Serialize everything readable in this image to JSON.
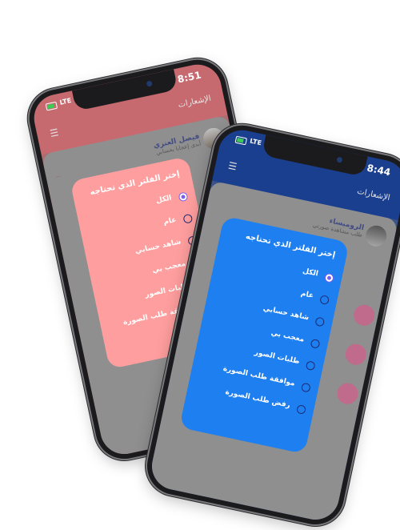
{
  "phone_left": {
    "status": {
      "time": "8:51",
      "network": "LTE"
    },
    "header": {
      "title": "الإشعارات",
      "filter_icon": "filter-icon"
    },
    "profile": {
      "name": "فيصل العنزي",
      "subtitle": "أبدى إعجابا بحسابي"
    },
    "filter_sheet": {
      "title": "إختر الفلتر الذي تحتاجه",
      "options": [
        "الكل",
        "عام",
        "شاهد حسابي",
        "معجب بي",
        "طلبات الصور",
        "موافقة طلب الصورة"
      ]
    },
    "colors": {
      "header": "#c76a70",
      "sheet": "#ff9e9e"
    }
  },
  "phone_right": {
    "status": {
      "time": "8:44",
      "network": "LTE"
    },
    "header": {
      "title": "الإشعارات",
      "filter_icon": "filter-icon"
    },
    "profile": {
      "name": "الروميساء",
      "subtitle": "طلب مشاهدة صورتي"
    },
    "filter_sheet": {
      "title": "إختر الفلتر الذي تحتاجه",
      "options": [
        "الكل",
        "عام",
        "شاهد حسابي",
        "معجب بي",
        "طلبات الصور",
        "موافقة طلب الصورة",
        "رفض طلب الصورة"
      ]
    },
    "colors": {
      "header": "#1b3f8f",
      "sheet": "#1d7ff0"
    }
  }
}
